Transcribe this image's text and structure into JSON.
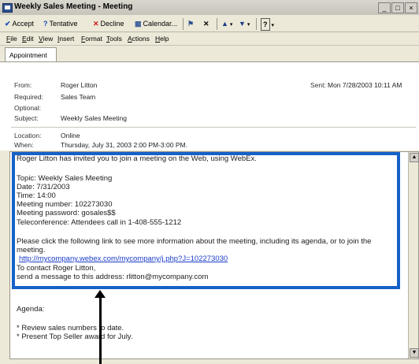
{
  "window": {
    "title": "Weekly Sales Meeting - Meeting",
    "controls": [
      "_",
      "□",
      "×"
    ]
  },
  "toolbar": {
    "accept": "Accept",
    "tentative": "Tentative",
    "decline": "Decline",
    "calendar": "Calendar...",
    "help_glyph": "?"
  },
  "menu": [
    "File",
    "Edit",
    "View",
    "Insert",
    "Format",
    "Tools",
    "Actions",
    "Help"
  ],
  "tabs": {
    "appointment": "Appointment"
  },
  "header": {
    "from_label": "From:",
    "from": "Roger Litton",
    "sent_label": "Sent:",
    "sent": "Mon 7/28/2003 10:11 AM",
    "required_label": "Required:",
    "required": "Sales Team",
    "optional_label": "Optional:",
    "optional": "",
    "subject_label": "Subject:",
    "subject": "Weekly Sales Meeting",
    "location_label": "Location:",
    "location": "Online",
    "when_label": "When:",
    "when": "Thursday, July 31, 2003 2:00 PM-3:00 PM."
  },
  "message": {
    "intro": "Roger Litton has invited you to join a meeting on the Web, using WebEx.",
    "topic": "Topic: Weekly Sales Meeting",
    "date": "Date: 7/31/2003",
    "time": "Time: 14:00",
    "meeting_number": "Meeting number: 102273030",
    "meeting_password": "Meeting password: gosales$$",
    "teleconference": "Teleconference: Attendees call in 1-408-555-1212",
    "click_line_1": "Please click the following link to see more information about the meeting, including its agenda, or to join the",
    "click_line_2": "meeting.",
    "link": "http://mycompany.webex.com/mycompany/j.php?J=102273030",
    "contact": "To contact Roger Litton,",
    "send": "send a message to this address: rlitton@mycompany.com",
    "agenda_label": "Agenda:",
    "agenda_1": "* Review sales numbers to date.",
    "agenda_2": "* Present Top Seller award for July."
  }
}
